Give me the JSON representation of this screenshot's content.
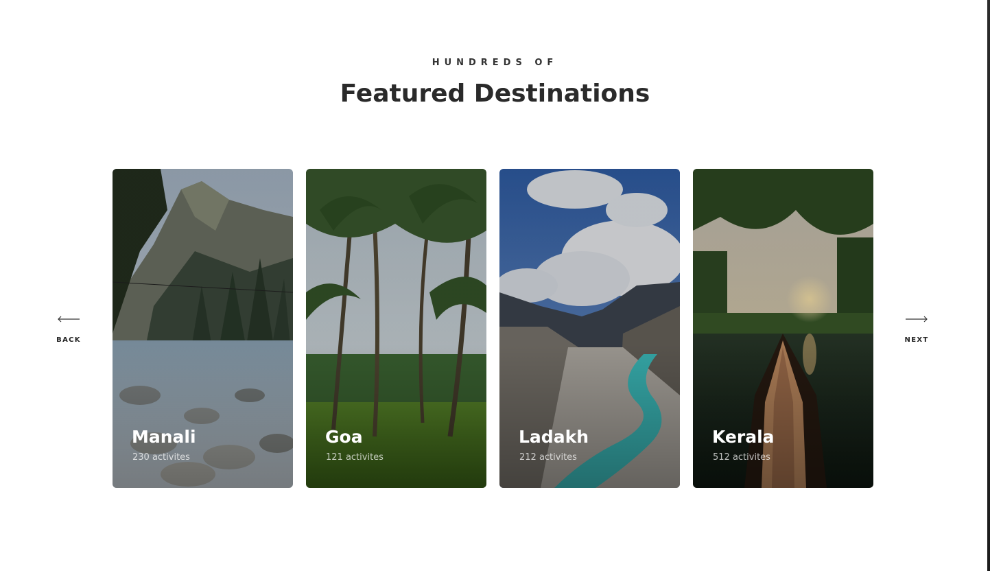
{
  "header": {
    "eyebrow": "HUNDREDS OF",
    "title": "Featured Destinations"
  },
  "navigation": {
    "back_label": "BACK",
    "next_label": "NEXT",
    "back_icon": "arrow-left-icon",
    "next_icon": "arrow-right-icon"
  },
  "destinations": [
    {
      "name": "Manali",
      "activities": "230 activites",
      "scene": "mountain river valley with pine trees"
    },
    {
      "name": "Goa",
      "activities": "121 activites",
      "scene": "coconut palm grove on green grass"
    },
    {
      "name": "Ladakh",
      "activities": "212 activites",
      "scene": "turquoise river between barren mountains under cloudy blue sky"
    },
    {
      "name": "Kerala",
      "activities": "512 activites",
      "scene": "wooden boat bow on backwater canal at sunset"
    }
  ]
}
